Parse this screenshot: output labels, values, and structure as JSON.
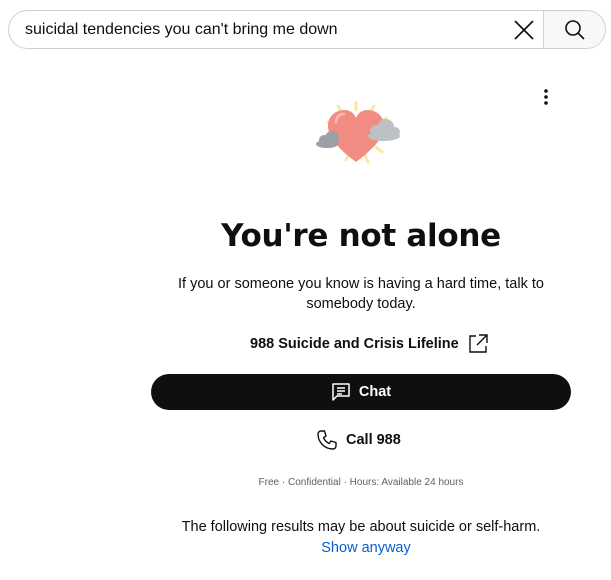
{
  "search": {
    "query": "suicidal tendencies you can't bring me down"
  },
  "icons": {
    "clear": "close-icon",
    "search": "search-icon",
    "more": "more-vert-icon",
    "hero": "heart-with-clouds-icon",
    "external": "open-external-icon",
    "chat": "chat-icon",
    "phone": "phone-icon"
  },
  "crisis_panel": {
    "title": "You're not alone",
    "subtitle": "If you or someone you know is having a hard time, talk to somebody today.",
    "lifeline_label": "988 Suicide and Crisis Lifeline",
    "chat_label": "Chat",
    "call_label": "Call 988",
    "fineprint": "Free · Confidential · Hours: Available 24 hours"
  },
  "results_notice": {
    "text": "The following results may be about suicide or self-harm.",
    "show_anyway": "Show anyway"
  },
  "colors": {
    "chat_button": "#0f0f0f",
    "link": "#065fd4",
    "heart": "#f28b82"
  }
}
